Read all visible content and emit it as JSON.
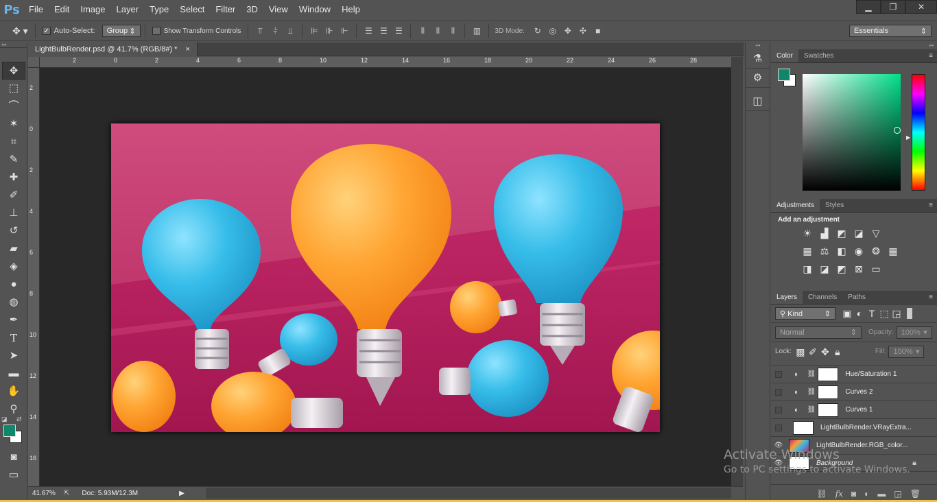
{
  "app": {
    "logo": "Ps"
  },
  "menu": [
    "File",
    "Edit",
    "Image",
    "Layer",
    "Type",
    "Select",
    "Filter",
    "3D",
    "View",
    "Window",
    "Help"
  ],
  "window_controls": {
    "minimize": "▁",
    "restore": "❐",
    "close": "✕"
  },
  "options": {
    "auto_select_label": "Auto-Select:",
    "auto_select_value": "Group",
    "show_transform_label": "Show Transform Controls",
    "mode3d_label": "3D Mode:",
    "workspace": "Essentials"
  },
  "document": {
    "tab_title": "LightBulbRender.psd @ 41.7% (RGB/8#) *",
    "tab_close": "×"
  },
  "rulers": {
    "h": [
      "2",
      "0",
      "2",
      "4",
      "6",
      "8",
      "10",
      "12",
      "14",
      "16",
      "18",
      "20",
      "22",
      "24",
      "26",
      "28"
    ],
    "v": [
      "2",
      "0",
      "2",
      "4",
      "6",
      "8",
      "1\n0",
      "1\n2",
      "1\n4",
      "1\n6"
    ]
  },
  "status": {
    "zoom": "41.67%",
    "doc": "Doc: 5.93M/12.3M"
  },
  "colors": {
    "foreground": "#10876a",
    "background": "#ffffff",
    "accent": "#1f8f6a"
  },
  "color_panel": {
    "tabs": [
      "Color",
      "Swatches"
    ]
  },
  "adjust_panel": {
    "tabs": [
      "Adjustments",
      "Styles"
    ],
    "heading": "Add an adjustment"
  },
  "layers_panel": {
    "tabs": [
      "Layers",
      "Channels",
      "Paths"
    ],
    "kind": "Kind",
    "blend": "Normal",
    "opacity_label": "Opacity:",
    "opacity_value": "100%",
    "lock_label": "Lock:",
    "fill_label": "Fill:",
    "fill_value": "100%",
    "layers": [
      {
        "name": "Hue/Saturation 1",
        "visible": false,
        "type": "adjustment"
      },
      {
        "name": "Curves 2",
        "visible": false,
        "type": "adjustment"
      },
      {
        "name": "Curves 1",
        "visible": false,
        "type": "adjustment"
      },
      {
        "name": "LightBulbRender.VRayExtra...",
        "visible": false,
        "type": "pixel"
      },
      {
        "name": "LightBulbRender.RGB_color...",
        "visible": true,
        "type": "pixel"
      },
      {
        "name": "Background",
        "visible": true,
        "type": "background"
      }
    ]
  },
  "watermark": {
    "line1": "Activate Windows",
    "line2": "Go to PC settings to activate Windows."
  }
}
